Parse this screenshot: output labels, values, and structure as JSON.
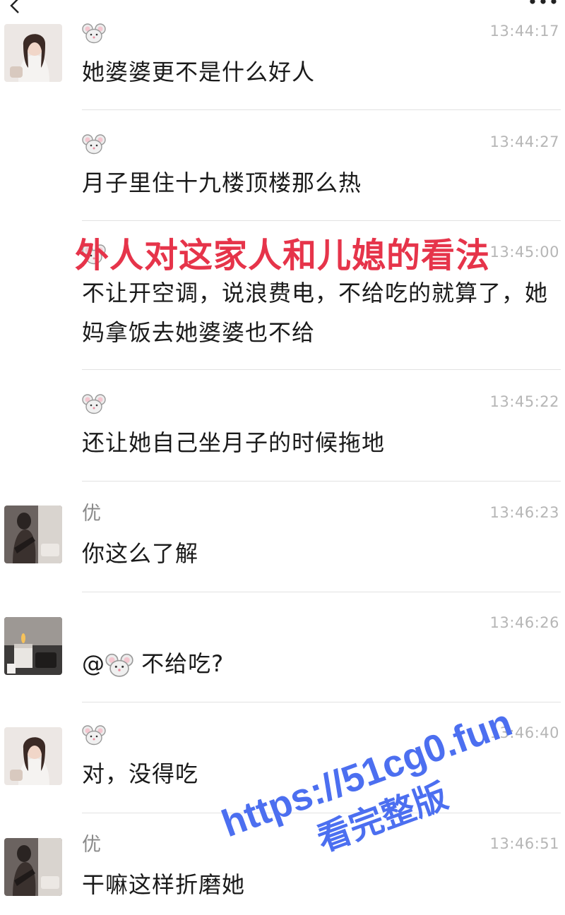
{
  "header": {
    "back_icon": "chevron-left-icon",
    "more_icon": "more-dots-icon"
  },
  "messages": [
    {
      "sender": "🐭",
      "time": "13:44:17",
      "text": "她婆婆更不是什么好人",
      "avatar": "woman-photo"
    },
    {
      "sender": "🐭",
      "time": "13:44:27",
      "text": "月子里住十九楼顶楼那么热",
      "avatar": null
    },
    {
      "sender": "🐭",
      "time": "13:45:00",
      "text": "不让开空调，说浪费电，不给吃的就算了，她妈拿饭去她婆婆也不给",
      "avatar": null
    },
    {
      "sender": "🐭",
      "time": "13:45:22",
      "text": "还让她自己坐月子的时候拖地",
      "avatar": null
    },
    {
      "sender": "优",
      "time": "13:46:23",
      "text": "你这么了解",
      "avatar": "dark-photo"
    },
    {
      "sender": "",
      "time": "13:46:26",
      "text_prefix": "@",
      "text_suffix": " 不给吃?",
      "avatar": "candle-photo"
    },
    {
      "sender": "🐭",
      "time": "13:46:40",
      "text": "对，没得吃",
      "avatar": "woman-photo"
    },
    {
      "sender": "优",
      "time": "13:46:51",
      "text": "干嘛这样折磨她",
      "avatar": "dark-photo"
    }
  ],
  "overlay": {
    "title": "外人对这家人和儿媳的看法",
    "watermark_url": "https://51cg0.fun",
    "watermark_sub": "看完整版",
    "title_color": "#e6344a",
    "watermark_color": "#4c6ff0"
  }
}
